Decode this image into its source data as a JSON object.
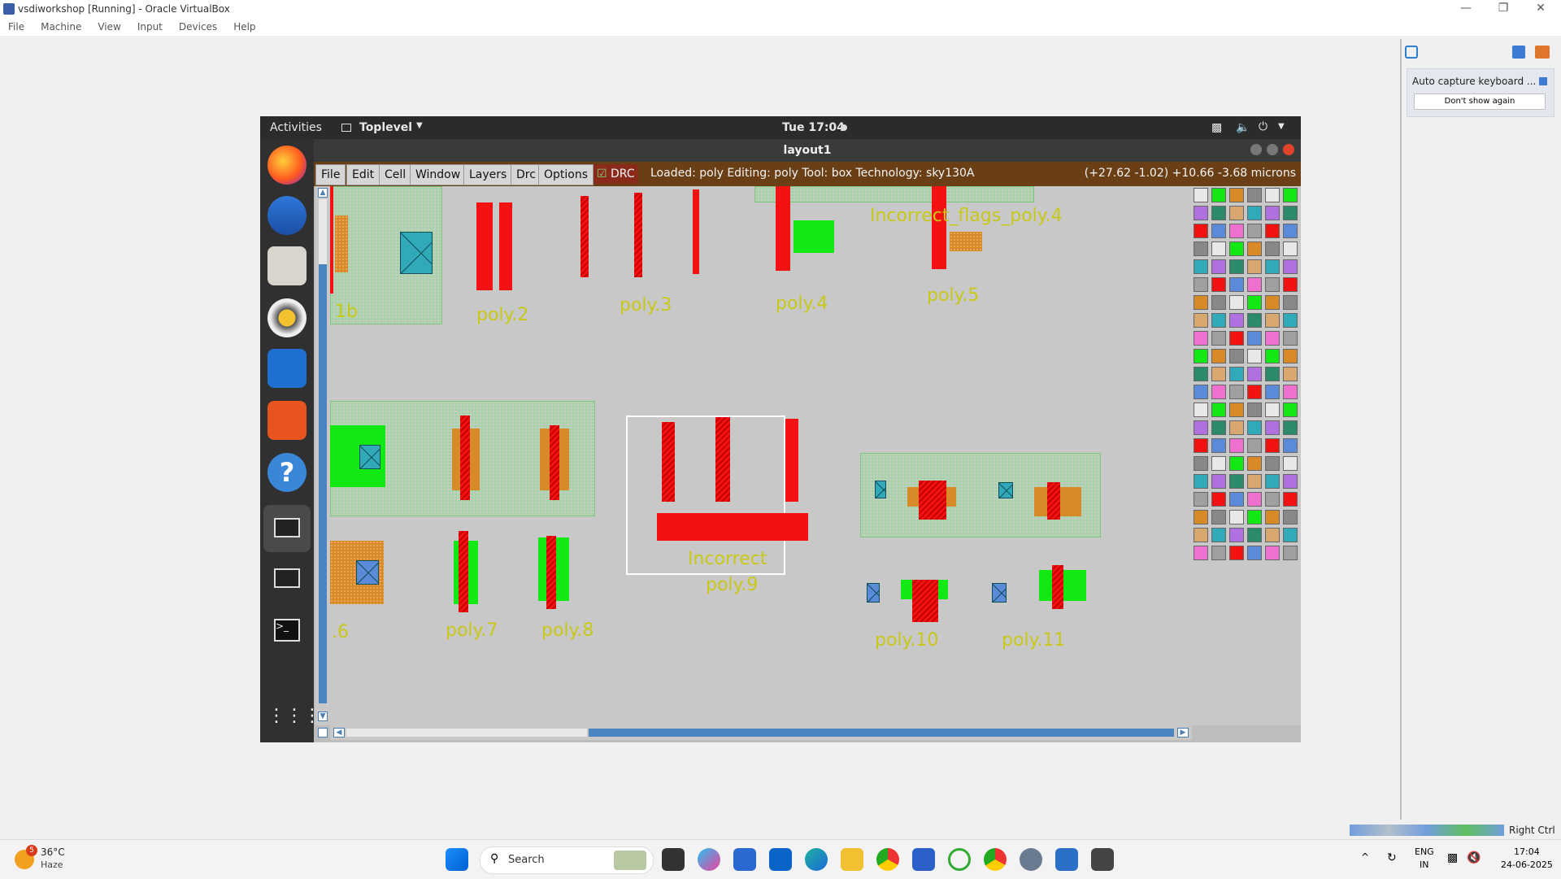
{
  "vbox": {
    "title": "vsdiworkshop [Running] - Oracle VirtualBox",
    "menu": [
      "File",
      "Machine",
      "View",
      "Input",
      "Devices",
      "Help"
    ],
    "right_ctrl": "Right Ctrl"
  },
  "notification": {
    "title": "Auto capture keyboard ...",
    "dont_show": "Don't show again"
  },
  "gnome": {
    "activities": "Activities",
    "app_menu": "Toplevel",
    "clock": "Tue 17:04"
  },
  "magic": {
    "window_title": "layout1",
    "menu": [
      "File",
      "Edit",
      "Cell",
      "Window",
      "Layers",
      "Drc",
      "Options"
    ],
    "drc_label": "DRC",
    "status": "Loaded: poly Editing: poly Tool: box  Technology: sky130A",
    "coords": "(+27.62 -1.02) +10.66 -3.68 microns"
  },
  "layout_labels": {
    "l1b": "1b",
    "poly2": "poly.2",
    "poly3": "poly.3",
    "poly4": "poly.4",
    "poly5": "poly.5",
    "incorrect_flags": "Incorrect_flags_poly.4",
    "poly6": ".6",
    "poly7": "poly.7",
    "poly8": "poly.8",
    "incorrect": "Incorrect",
    "poly9": "poly.9",
    "poly10": "poly.10",
    "poly11": "poly.11"
  },
  "taskbar": {
    "weather_temp": "36°C",
    "weather_desc": "Haze",
    "weather_badge": "5",
    "search": "Search",
    "lang1": "ENG",
    "lang2": "IN",
    "time": "17:04",
    "date": "24-06-2025"
  },
  "colors": {
    "poly": "#f21212",
    "diff": "#12e812",
    "contact": "#32a9b8",
    "label": "#c8c818",
    "magic_bar": "#6b3f15"
  }
}
